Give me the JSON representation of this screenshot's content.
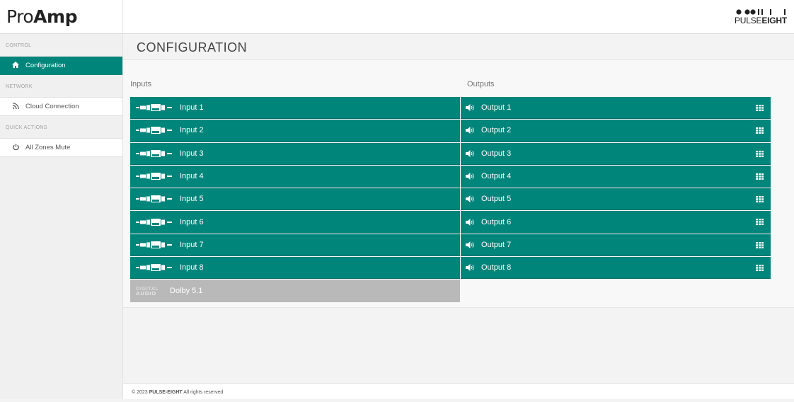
{
  "app": {
    "logo_pro": "Pro",
    "logo_amp": "Amp",
    "brand_pulse": "PULSE",
    "brand_eight": "EIGHT",
    "accent_color": "#00857b"
  },
  "sidebar": {
    "sections": [
      {
        "label": "CONTROL",
        "items": [
          {
            "label": "Configuration",
            "icon": "home-icon",
            "active": true
          }
        ]
      },
      {
        "label": "NETWORK",
        "items": [
          {
            "label": "Cloud Connection",
            "icon": "rss-icon"
          }
        ]
      },
      {
        "label": "QUICK ACTIONS",
        "items": [
          {
            "label": "All Zones Mute",
            "icon": "power-icon"
          }
        ]
      }
    ]
  },
  "main": {
    "title": "CONFIGURATION",
    "inputs_header": "Inputs",
    "outputs_header": "Outputs",
    "inputs": [
      "Input 1",
      "Input 2",
      "Input 3",
      "Input 4",
      "Input 5",
      "Input 6",
      "Input 7",
      "Input 8"
    ],
    "outputs": [
      "Output 1",
      "Output 2",
      "Output 3",
      "Output 4",
      "Output 5",
      "Output 6",
      "Output 7",
      "Output 8"
    ],
    "digital_badge_top": "DIGITAL",
    "digital_badge_bottom": "AUDIO",
    "digital_label": "Dolby 5.1"
  },
  "footer": {
    "prefix": "© 2023 ",
    "company": "PULSE-EIGHT",
    "suffix": " All rights reserved"
  }
}
